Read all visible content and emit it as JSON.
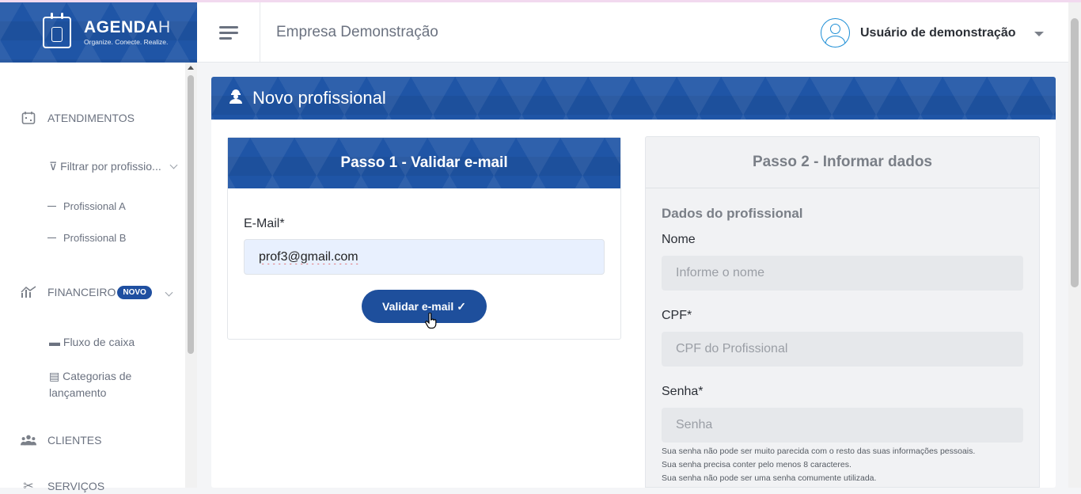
{
  "brand": {
    "name_bold": "AGENDA",
    "name_light": "H",
    "tagline": "Organize. Conecte. Realize."
  },
  "topbar": {
    "company": "Empresa Demonstração",
    "user": "Usuário de demonstração"
  },
  "sidebar": {
    "atendimentos": {
      "label": "ATENDIMENTOS",
      "filter": "Filtrar por profissio...",
      "professionals": [
        "Profissional A",
        "Profissional B"
      ]
    },
    "financeiro": {
      "label": "FINANCEIRO",
      "badge": "NOVO",
      "items": [
        "Fluxo de caixa",
        "Categorias de lançamento"
      ]
    },
    "clientes": {
      "label": "CLIENTES"
    },
    "servicos": {
      "label": "SERVIÇOS"
    }
  },
  "page": {
    "title": "Novo profissional"
  },
  "step1": {
    "title": "Passo 1 - Validar e-mail",
    "email_label": "E-Mail*",
    "email_value": "prof3@gmail.com",
    "button": "Validar e-mail ✓"
  },
  "step2": {
    "title": "Passo 2 - Informar dados",
    "section": "Dados do profissional",
    "nome_label": "Nome",
    "nome_placeholder": "Informe o nome",
    "cpf_label": "CPF*",
    "cpf_placeholder": "CPF do Profissional",
    "senha_label": "Senha*",
    "senha_placeholder": "Senha",
    "hints": [
      "Sua senha não pode ser muito parecida com o resto das suas informações pessoais.",
      "Sua senha precisa conter pelo menos 8 caracteres.",
      "Sua senha não pode ser uma senha comumente utilizada."
    ]
  },
  "colors": {
    "brand_blue": "#1f55a6",
    "button_blue": "#1e4f9c",
    "avatar_blue": "#1f8fd6"
  }
}
